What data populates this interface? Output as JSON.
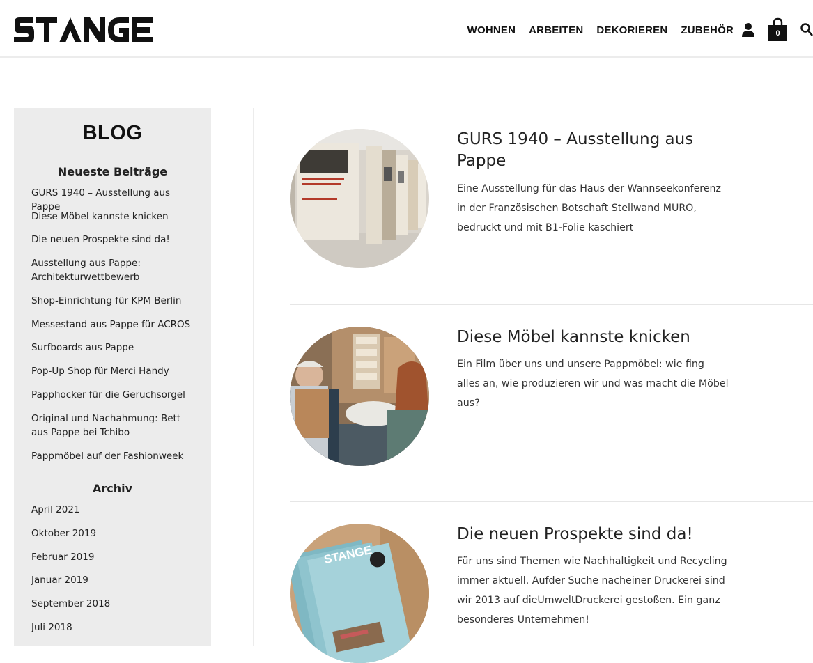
{
  "header": {
    "logo_text": "STANGE",
    "nav": [
      "WOHNEN",
      "ARBEITEN",
      "DEKORIEREN",
      "ZUBEHÖR"
    ],
    "cart_count": "0",
    "icons": [
      "user-icon",
      "shopping-bag-icon",
      "search-icon"
    ]
  },
  "sidebar": {
    "title": "BLOG",
    "recent_heading": "Neueste Beiträge",
    "recent_posts": [
      "GURS 1940 – Ausstellung aus Pappe",
      "Diese Möbel kannste knicken",
      "Die neuen Prospekte sind da!",
      "Ausstellung aus Pappe: Architekturwettbewerb",
      "Shop-Einrichtung für KPM Berlin",
      "Messestand aus Pappe für ACROS",
      "Surfboards aus Pappe",
      "Pop-Up Shop für Merci Handy",
      "Papphocker für die Geruchsorgel",
      "Original und Nachahmung: Bett aus Pappe bei Tchibo",
      "Pappmöbel auf der Fashionweek"
    ],
    "archive_heading": "Archiv",
    "archive": [
      "April 2021",
      "Oktober 2019",
      "Februar 2019",
      "Januar 2019",
      "September 2018",
      "Juli 2018"
    ]
  },
  "posts": [
    {
      "title": "GURS 1940 – Ausstellung aus Pappe",
      "excerpt": "Eine Ausstellung für das Haus der Wannseekonferenz in der Französischen Botschaft Stellwand MURO, bedruckt und mit B1-Folie kaschiert"
    },
    {
      "title": "Diese Möbel kannste knicken",
      "excerpt": "Ein Film über uns und unsere Pappmöbel: wie fing alles an, wie produzieren wir und was macht die Möbel aus?"
    },
    {
      "title": "Die neuen Prospekte sind da!",
      "excerpt": "Für uns sind Themen wie Nachhaltigkeit und Recycling immer aktuell. Aufder Suche nacheiner Druckerei sind wir 2013 auf dieUmweltDruckerei gestoßen. Ein ganz besonderes Unternehmen!",
      "thumb_magazine_text": "STANGE"
    }
  ],
  "colors": {
    "text": "#222222",
    "sidebar_bg": "#ececec",
    "brand_black": "#111111"
  }
}
